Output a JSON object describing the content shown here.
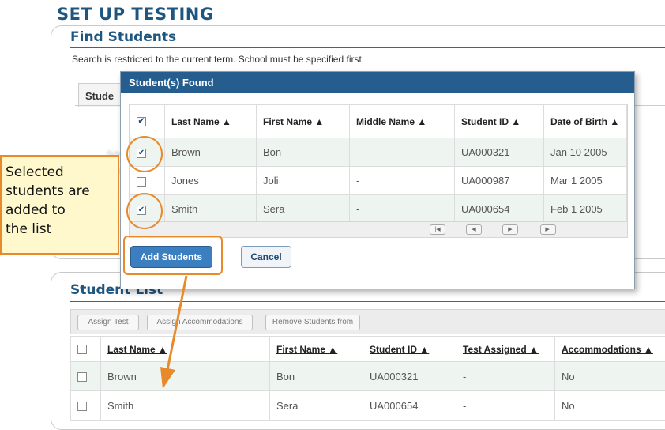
{
  "page": {
    "title": "SET UP TESTING"
  },
  "find_students": {
    "heading": "Find Students",
    "note": "Search is restricted to the current term. School must be specified first.",
    "tab_label": "Stude"
  },
  "modal": {
    "title": "Student(s) Found",
    "columns": [
      "Last Name ▲",
      "First Name ▲",
      "Middle Name ▲",
      "Student ID ▲",
      "Date of Birth ▲"
    ],
    "rows": [
      {
        "checked": true,
        "last": "Brown",
        "first": "Bon",
        "middle": "-",
        "id": "UA000321",
        "dob": "Jan 10 2005"
      },
      {
        "checked": false,
        "last": "Jones",
        "first": "Joli",
        "middle": "-",
        "id": "UA000987",
        "dob": "Mar 1 2005"
      },
      {
        "checked": true,
        "last": "Smith",
        "first": "Sera",
        "middle": "-",
        "id": "UA000654",
        "dob": "Feb 1 2005"
      }
    ],
    "add_button": "Add Students",
    "cancel_button": "Cancel"
  },
  "student_list": {
    "heading": "Student List",
    "toolbar": [
      "Assign Test",
      "Assign Accommodations",
      "Remove Students from"
    ],
    "columns": [
      "Last Name ▲",
      "First Name ▲",
      "Student ID ▲",
      "Test Assigned ▲",
      "Accommodations ▲"
    ],
    "rows": [
      {
        "last": "Brown",
        "first": "Bon",
        "id": "UA000321",
        "test": "-",
        "accom": "No"
      },
      {
        "last": "Smith",
        "first": "Sera",
        "id": "UA000654",
        "test": "-",
        "accom": "No"
      }
    ]
  },
  "callout": {
    "lines": [
      "Selected",
      "students are",
      "added to",
      "the list"
    ]
  },
  "colors": {
    "accent": "#e88a2c",
    "header_blue": "#255e8e",
    "title_blue": "#1f5680",
    "row_alt": "#eef5f0"
  }
}
